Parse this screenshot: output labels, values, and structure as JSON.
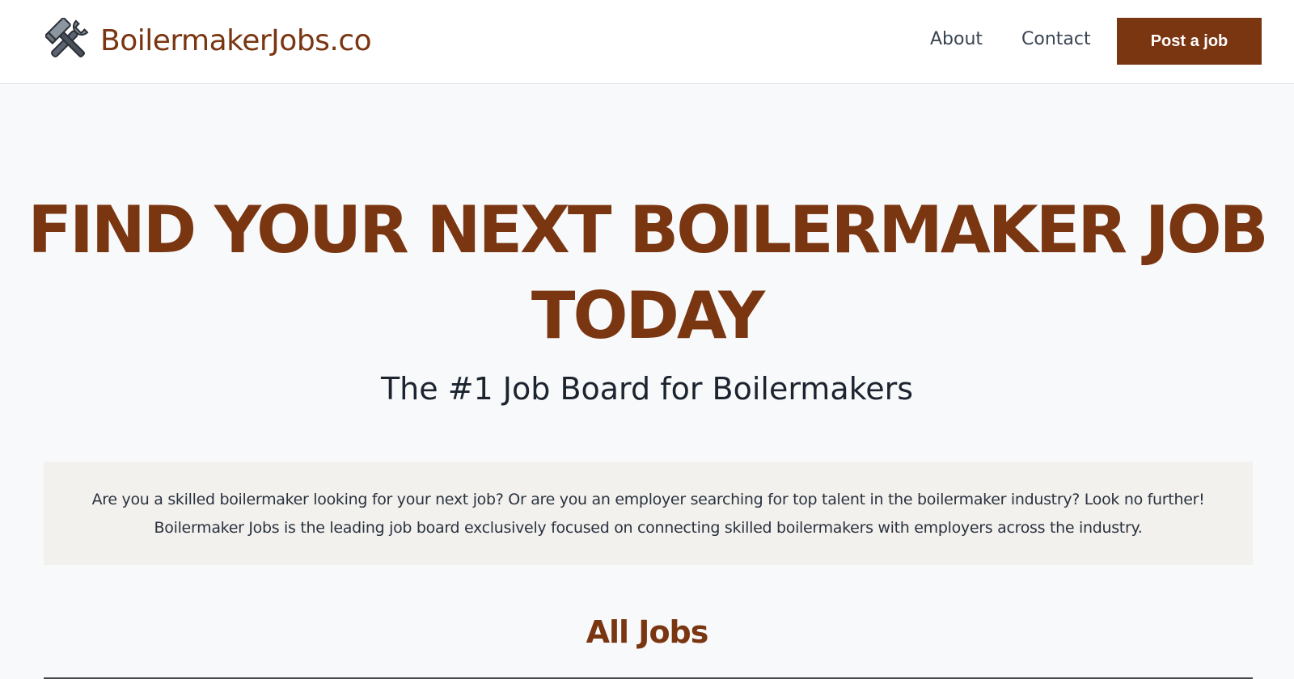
{
  "header": {
    "brand_name": "BoilermakerJobs.co",
    "brand_icon": "crossed-hammer-wrench-icon",
    "nav": {
      "about": "About",
      "contact": "Contact"
    },
    "post_button": "Post a job"
  },
  "hero": {
    "title": "FIND YOUR NEXT BOILERMAKER JOB TODAY",
    "subtitle": "The #1 Job Board for Boilermakers"
  },
  "intro": {
    "text": "Are you a skilled boilermaker looking for your next job? Or are you an employer searching for top talent in the boilermaker industry? Look no further! Boilermaker Jobs is the leading job board exclusively focused on connecting skilled boilermakers with employers across the industry."
  },
  "jobs_section": {
    "heading": "All Jobs"
  },
  "colors": {
    "brand": "#7a3511",
    "page_background": "#f8f9fa",
    "intro_background": "#f3f1ed",
    "text_dark": "#1c2430"
  }
}
